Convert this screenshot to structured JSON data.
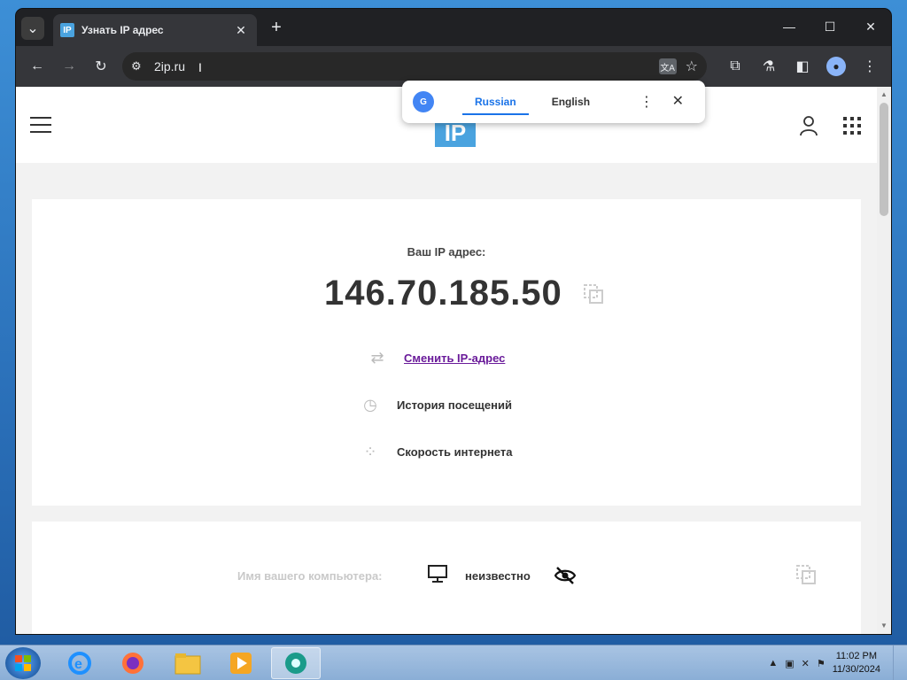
{
  "browser": {
    "tab_title": "Узнать IP адрес",
    "tab_favicon": "IP",
    "url": "2ip.ru",
    "tab_search_icon": "chevron-down-icon",
    "new_tab_icon": "plus-icon",
    "window_controls": [
      "minimize-icon",
      "maximize-icon",
      "close-icon"
    ]
  },
  "translate_popup": {
    "languages": [
      "Russian",
      "English"
    ],
    "selected": "Russian"
  },
  "site": {
    "logo_text": "IP",
    "ip_label": "Ваш IP адрес:",
    "ip_value": "146.70.185.50",
    "links": [
      {
        "label": "Сменить IP-адрес",
        "icon": "change-ip-icon",
        "active": true
      },
      {
        "label": "История посещений",
        "icon": "history-icon",
        "active": false
      },
      {
        "label": "Скорость интернета",
        "icon": "speed-icon",
        "active": false
      }
    ],
    "pc_name_label": "Имя вашего компьютера:",
    "pc_name_value": "неизвестно"
  },
  "taskbar": {
    "apps": [
      "internet-explorer-icon",
      "firefox-icon",
      "file-explorer-icon",
      "media-player-icon",
      "chrome-browser-icon"
    ],
    "active_app": "chrome-browser-icon",
    "time": "11:02 PM",
    "date": "11/30/2024"
  },
  "colors": {
    "accent_logo": "#4aa3df",
    "link_active": "#6a1b9a",
    "translate_selected": "#1a73e8"
  }
}
